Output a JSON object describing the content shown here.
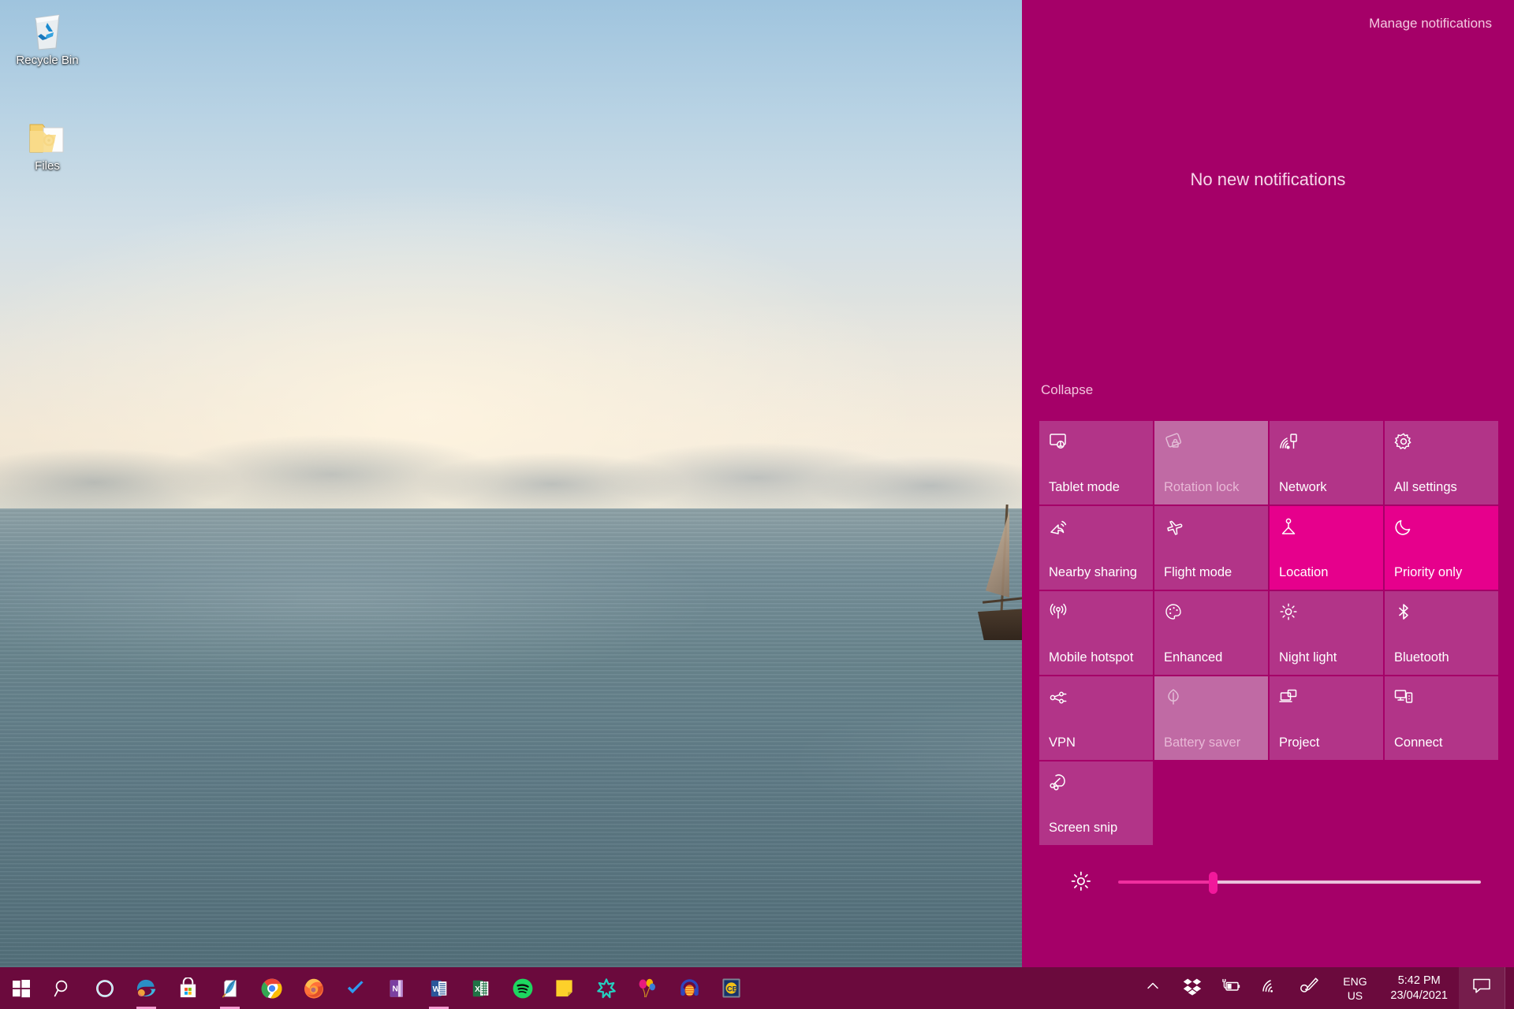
{
  "desktop": {
    "icons": [
      {
        "name": "recycle-bin",
        "label": "Recycle Bin"
      },
      {
        "name": "files-folder",
        "label": "Files"
      }
    ]
  },
  "action_center": {
    "manage_notifications_label": "Manage notifications",
    "empty_state_text": "No new notifications",
    "collapse_label": "Collapse",
    "panel_color": "#A50068",
    "tile_color": "#B23488",
    "tile_active_color": "#E6008C",
    "tile_disabled_color": "#C06AA4",
    "tiles": [
      {
        "label": "Tablet mode",
        "icon": "tablet-mode-icon",
        "state": "normal"
      },
      {
        "label": "Rotation lock",
        "icon": "rotation-lock-icon",
        "state": "disabled"
      },
      {
        "label": "Network",
        "icon": "network-icon",
        "state": "normal"
      },
      {
        "label": "All settings",
        "icon": "gear-icon",
        "state": "normal"
      },
      {
        "label": "Nearby sharing",
        "icon": "nearby-sharing-icon",
        "state": "normal"
      },
      {
        "label": "Flight mode",
        "icon": "airplane-icon",
        "state": "normal"
      },
      {
        "label": "Location",
        "icon": "location-icon",
        "state": "active"
      },
      {
        "label": "Priority only",
        "icon": "moon-icon",
        "state": "active"
      },
      {
        "label": "Mobile hotspot",
        "icon": "hotspot-icon",
        "state": "normal"
      },
      {
        "label": "Enhanced",
        "icon": "palette-icon",
        "state": "normal"
      },
      {
        "label": "Night light",
        "icon": "sun-icon",
        "state": "normal"
      },
      {
        "label": "Bluetooth",
        "icon": "bluetooth-icon",
        "state": "normal"
      },
      {
        "label": "VPN",
        "icon": "vpn-icon",
        "state": "normal"
      },
      {
        "label": "Battery saver",
        "icon": "leaf-icon",
        "state": "disabled"
      },
      {
        "label": "Project",
        "icon": "project-icon",
        "state": "normal"
      },
      {
        "label": "Connect",
        "icon": "connect-icon",
        "state": "normal"
      },
      {
        "label": "Screen snip",
        "icon": "screen-snip-icon",
        "state": "normal"
      }
    ],
    "brightness": {
      "icon": "brightness-icon",
      "value_percent": 26
    }
  },
  "taskbar": {
    "background_color": "#6B0A3D",
    "start_label": "Start",
    "items": [
      {
        "name": "start-button",
        "icon": "windows-logo-icon",
        "running": false
      },
      {
        "name": "search-button",
        "icon": "search-icon",
        "running": false
      },
      {
        "name": "cortana-button",
        "icon": "cortana-icon",
        "running": false
      },
      {
        "name": "edge-button",
        "icon": "edge-icon",
        "running": true
      },
      {
        "name": "microsoft-store-button",
        "icon": "store-icon",
        "running": false
      },
      {
        "name": "journal-button",
        "icon": "feather-note-icon",
        "running": true
      },
      {
        "name": "chrome-button",
        "icon": "chrome-icon",
        "running": false
      },
      {
        "name": "firefox-button",
        "icon": "firefox-icon",
        "running": false
      },
      {
        "name": "todo-button",
        "icon": "checkmark-icon",
        "running": false
      },
      {
        "name": "onenote-button",
        "icon": "onenote-icon",
        "running": false
      },
      {
        "name": "word-button",
        "icon": "word-icon",
        "running": true
      },
      {
        "name": "excel-button",
        "icon": "excel-icon",
        "running": false
      },
      {
        "name": "spotify-button",
        "icon": "spotify-icon",
        "running": false
      },
      {
        "name": "sticky-notes-button",
        "icon": "sticky-note-icon",
        "running": false
      },
      {
        "name": "star-app-button",
        "icon": "star-burst-icon",
        "running": false
      },
      {
        "name": "balloons-button",
        "icon": "balloons-icon",
        "running": false
      },
      {
        "name": "headphones-button",
        "icon": "headphones-icon",
        "running": false
      },
      {
        "name": "cb-app-button",
        "icon": "cb-badge-icon",
        "running": false
      }
    ],
    "tray": {
      "show_hidden_icon": "chevron-up-icon",
      "items": [
        {
          "name": "dropbox-tray-icon",
          "icon": "dropbox-icon"
        },
        {
          "name": "battery-tray-icon",
          "icon": "battery-charging-icon"
        },
        {
          "name": "network-tray-icon",
          "icon": "wifi-icon"
        },
        {
          "name": "pen-tray-icon",
          "icon": "pen-workspace-icon"
        }
      ],
      "language": {
        "line1": "ENG",
        "line2": "US"
      },
      "clock": {
        "time": "5:42 PM",
        "date": "23/04/2021"
      },
      "action_center_icon": "action-center-icon"
    }
  }
}
